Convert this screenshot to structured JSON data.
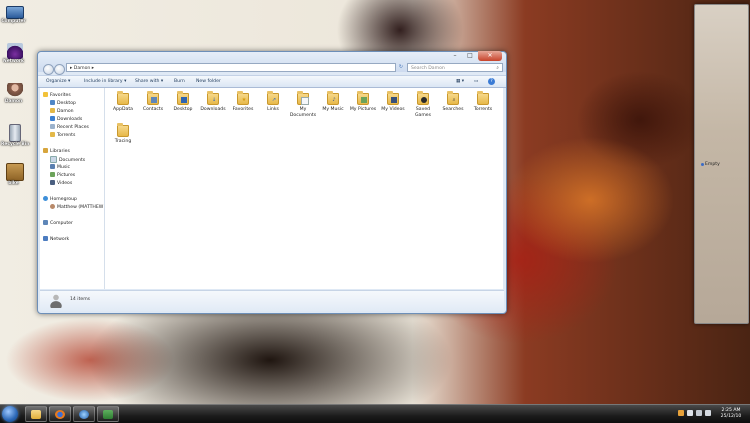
{
  "desktop": {
    "icons": [
      {
        "label": "Computer",
        "icon": "computer-icon"
      },
      {
        "label": "Network",
        "icon": "network-icon"
      },
      {
        "label": "Damon",
        "icon": "user-folder-icon"
      },
      {
        "label": "Recycle Bin",
        "icon": "recycle-bin-icon"
      },
      {
        "label": "bike",
        "icon": "bike-icon"
      }
    ]
  },
  "window": {
    "breadcrumb": "Damon",
    "search_placeholder": "Search Damon",
    "toolbar": {
      "organize": "Organize",
      "include_in_library": "Include in library",
      "share_with": "Share with",
      "burn": "Burn",
      "new_folder": "New folder"
    },
    "nav": {
      "favorites_header": "Favorites",
      "favorites": [
        "Desktop",
        "Damon",
        "Downloads",
        "Recent Places",
        "Torrents"
      ],
      "libraries_header": "Libraries",
      "libraries": [
        "Documents",
        "Music",
        "Pictures",
        "Videos"
      ],
      "homegroup_header": "Homegroup",
      "homegroup_user": "Matthew (MATTHEW",
      "computer": "Computer",
      "network": "Network"
    },
    "files": [
      {
        "name": "AppData",
        "overlay": ""
      },
      {
        "name": "Contacts",
        "overlay": "contacts-icon"
      },
      {
        "name": "Desktop",
        "overlay": "desktop-icon"
      },
      {
        "name": "Downloads",
        "overlay": "downloads-icon"
      },
      {
        "name": "Favorites",
        "overlay": "star-icon"
      },
      {
        "name": "Links",
        "overlay": "links-icon"
      },
      {
        "name": "My Documents",
        "overlay": "document-icon"
      },
      {
        "name": "My Music",
        "overlay": "music-icon"
      },
      {
        "name": "My Pictures",
        "overlay": "pictures-icon"
      },
      {
        "name": "My Videos",
        "overlay": "videos-icon"
      },
      {
        "name": "Saved Games",
        "overlay": "games-icon"
      },
      {
        "name": "Searches",
        "overlay": "search-icon"
      },
      {
        "name": "Torrents",
        "overlay": ""
      },
      {
        "name": "Tracing",
        "overlay": ""
      }
    ],
    "item_count": "14 items"
  },
  "gadget": {
    "label": "Empty"
  },
  "taskbar": {
    "clock_time": "2:25 AM",
    "clock_date": "25/12/10"
  }
}
